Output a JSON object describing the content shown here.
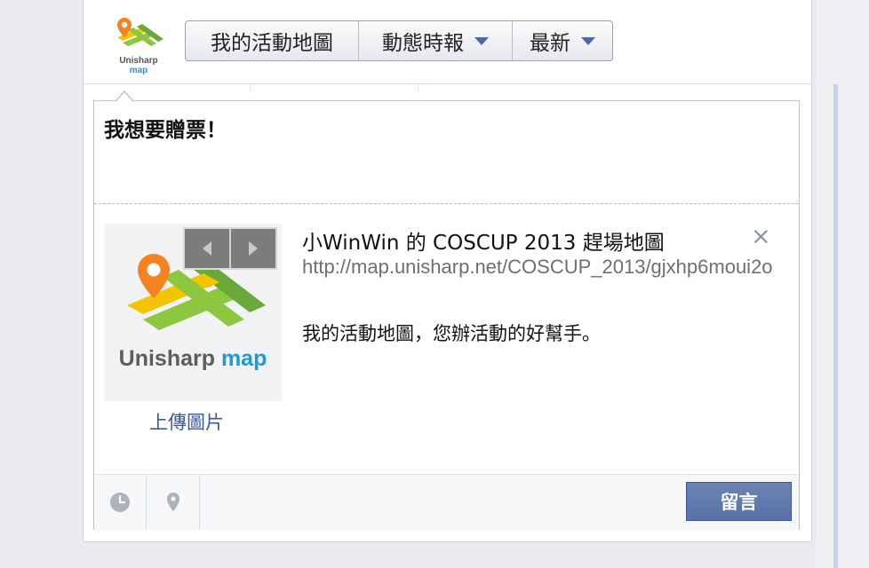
{
  "header": {
    "logo": {
      "brand_main": "Unisharp",
      "brand_accent": "map"
    },
    "segments": [
      {
        "label": "我的活動地圖",
        "has_dropdown": false
      },
      {
        "label": "動態時報",
        "has_dropdown": true
      },
      {
        "label": "最新",
        "has_dropdown": true
      }
    ]
  },
  "composer": {
    "status_text": "我想要贈票！",
    "preview": {
      "thumbnail": {
        "brand_main": "Unisharp",
        "brand_accent": "map"
      },
      "upload_label": "上傳圖片",
      "title": "小WinWin 的 COSCUP 2013 趕場地圖",
      "url": "http://map.unisharp.net/COSCUP_2013/gjxhp6moui2o",
      "description": "我的活動地圖，您辦活動的好幫手。",
      "close_icon": "×"
    },
    "toolbar": {
      "clock_icon": "clock-icon",
      "location_icon": "location-pin-icon",
      "post_label": "留言"
    }
  },
  "colors": {
    "accent": "#3b5998",
    "post_button": "#5872a7",
    "brand_map": "#1e9ad6"
  }
}
